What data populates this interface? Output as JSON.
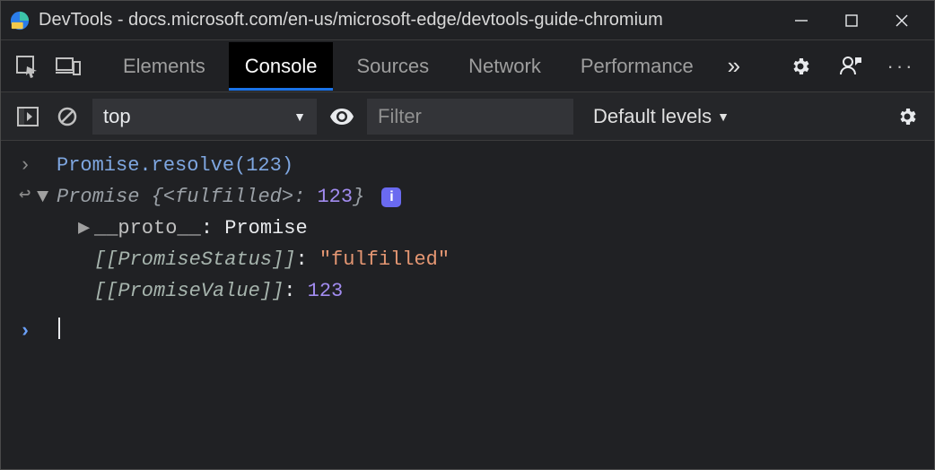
{
  "titlebar": {
    "title": "DevTools - docs.microsoft.com/en-us/microsoft-edge/devtools-guide-chromium"
  },
  "tabs": {
    "elements": "Elements",
    "console": "Console",
    "sources": "Sources",
    "network": "Network",
    "performance": "Performance"
  },
  "filterbar": {
    "context": "top",
    "filter_placeholder": "Filter",
    "levels": "Default levels"
  },
  "console": {
    "input": "Promise.resolve(123)",
    "result": {
      "type": "Promise",
      "open": " {",
      "state_open": "<",
      "state": "fulfilled",
      "state_close": ">",
      "colon": ": ",
      "value": "123",
      "close": "}",
      "info": "i"
    },
    "proto": {
      "key": "__proto__",
      "colon": ": ",
      "value": "Promise"
    },
    "status": {
      "key": "[[PromiseStatus]]",
      "colon": ": ",
      "value": "\"fulfilled\""
    },
    "pvalue": {
      "key": "[[PromiseValue]]",
      "colon": ": ",
      "value": "123"
    }
  }
}
